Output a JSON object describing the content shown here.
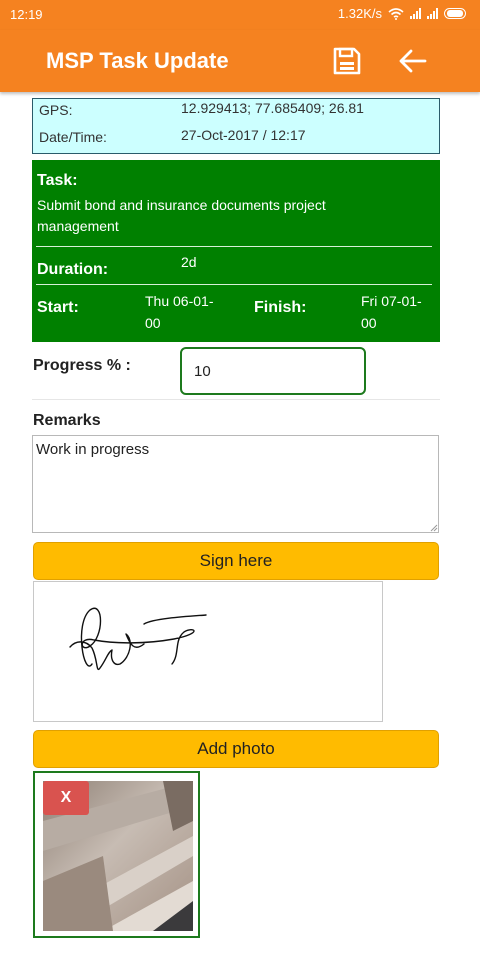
{
  "status_bar": {
    "time": "12:19",
    "net_speed": "1.32K/s"
  },
  "app_bar": {
    "title": "MSP Task Update"
  },
  "gps": {
    "gps_label": "GPS:",
    "gps_value": "12.929413; 77.685409; 26.81",
    "datetime_label": "Date/Time:",
    "datetime_value": "27-Oct-2017 / 12:17"
  },
  "task": {
    "task_label": "Task:",
    "task_value_line1": "Submit bond and insurance documents project",
    "task_value_line2": "management",
    "duration_label": "Duration:",
    "duration_value": "2d",
    "start_label": "Start:",
    "start_value_line1": "Thu 06-01-",
    "start_value_line2": "00",
    "finish_label": "Finish:",
    "finish_value_line1": "Fri 07-01-",
    "finish_value_line2": "00"
  },
  "progress": {
    "label": "Progress % :",
    "value": "10"
  },
  "remarks": {
    "label": "Remarks",
    "value": "Work in progress"
  },
  "buttons": {
    "sign": "Sign here",
    "add_photo": "Add photo",
    "remove_photo": "X"
  },
  "colors": {
    "app_bar": "#f58220",
    "task_bg": "#008000",
    "gps_bg": "#ccffff",
    "button": "#ffbb00",
    "remove_button": "#d9534f"
  },
  "icons": {
    "save": "save-icon",
    "back": "arrow-left-icon",
    "wifi": "wifi-icon",
    "signal": "signal-icon",
    "battery": "battery-icon"
  }
}
